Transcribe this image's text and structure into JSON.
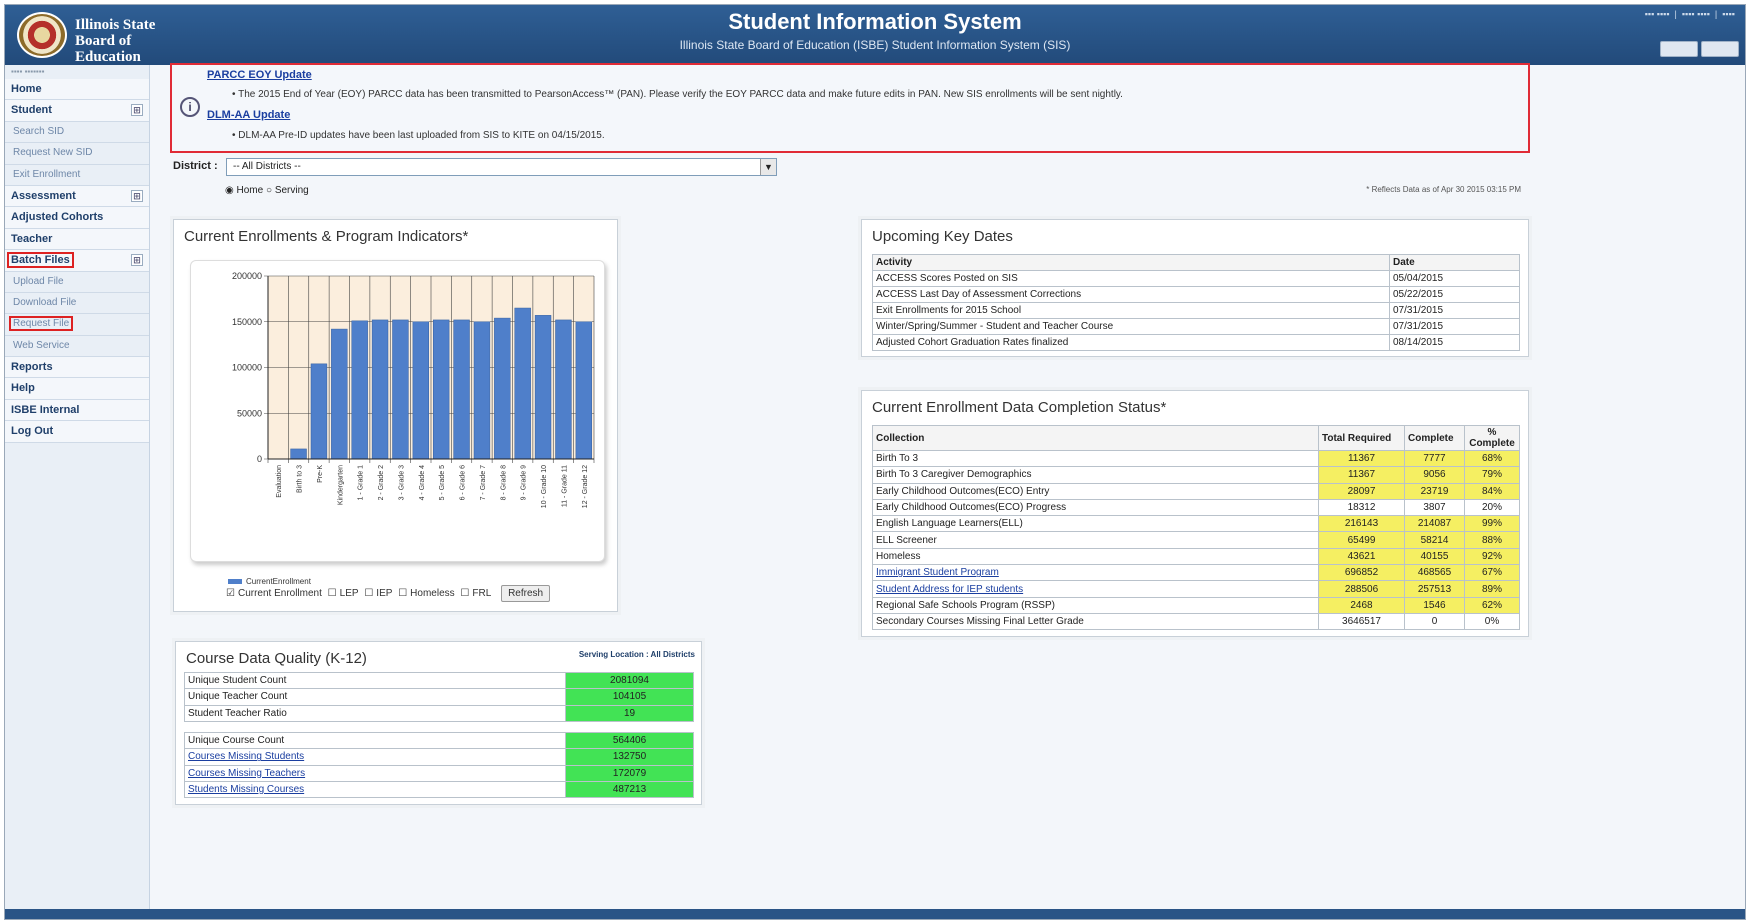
{
  "header": {
    "board_name": "Illinois State Board of Education",
    "app_title": "Student Information System",
    "app_subtitle": "Illinois State Board of Education (ISBE) Student Information System (SIS)"
  },
  "sidebar": {
    "items": [
      {
        "label": "Home",
        "level": "top"
      },
      {
        "label": "Student",
        "level": "top",
        "expand": "⊞"
      },
      {
        "label": "Search SID",
        "level": "sub"
      },
      {
        "label": "Request New SID",
        "level": "sub"
      },
      {
        "label": "Exit Enrollment",
        "level": "sub"
      },
      {
        "label": "Assessment",
        "level": "top",
        "expand": "⊞"
      },
      {
        "label": "Adjusted Cohorts",
        "level": "top"
      },
      {
        "label": "Teacher",
        "level": "top"
      },
      {
        "label": "Batch Files",
        "level": "top",
        "expand": "⊞",
        "highlight": true
      },
      {
        "label": "Upload File",
        "level": "sub"
      },
      {
        "label": "Download File",
        "level": "sub"
      },
      {
        "label": "Request File",
        "level": "sub",
        "highlight": true
      },
      {
        "label": "Web Service",
        "level": "sub"
      },
      {
        "label": "Reports",
        "level": "top"
      },
      {
        "label": "Help",
        "level": "top"
      },
      {
        "label": "ISBE Internal",
        "level": "top"
      },
      {
        "label": "Log Out",
        "level": "top"
      }
    ]
  },
  "notice": {
    "parcc_title": "PARCC EOY Update",
    "parcc_text": "• The 2015 End of Year (EOY) PARCC data has been transmitted to PearsonAccess™ (PAN). Please verify the EOY PARCC data and make future edits in PAN. New SIS enrollments will be sent nightly.",
    "dlm_title": "DLM-AA Update",
    "dlm_text": "• DLM-AA Pre-ID updates have been last uploaded from SIS to KITE on 04/15/2015."
  },
  "filters": {
    "district_label": "District :",
    "district_value": "-- All Districts --",
    "radio_home": "Home",
    "radio_serving": "Serving",
    "as_of": "* Reflects Data as of Apr 30 2015 03:15 PM"
  },
  "enrollment_panel": {
    "title": "Current Enrollments & Program Indicators*",
    "legend": "CurrentEnrollment",
    "checkboxes": [
      "Current Enrollment",
      "LEP",
      "IEP",
      "Homeless",
      "FRL"
    ],
    "refresh_label": "Refresh"
  },
  "chart_data": {
    "type": "bar",
    "title": "",
    "categories": [
      "Evaluation",
      "Birth to 3",
      "Pre-K",
      "Kindergarten",
      "1 - Grade 1",
      "2 - Grade 2",
      "3 - Grade 3",
      "4 - Grade 4",
      "5 - Grade 5",
      "6 - Grade 6",
      "7 - Grade 7",
      "8 - Grade 8",
      "9 - Grade 9",
      "10 - Grade 10",
      "11 - Grade 11",
      "12 - Grade 12"
    ],
    "series": [
      {
        "name": "CurrentEnrollment",
        "values": [
          0,
          11000,
          104000,
          142000,
          151000,
          152000,
          152000,
          150000,
          152000,
          152000,
          150000,
          154000,
          165000,
          157000,
          152000,
          150000
        ]
      }
    ],
    "yticks": [
      "0",
      "50000",
      "100000",
      "150000",
      "200000"
    ],
    "ylim": [
      0,
      200000
    ],
    "bar_color": "#4f7fca"
  },
  "key_dates": {
    "title": "Upcoming Key Dates",
    "headers": [
      "Activity",
      "Date"
    ],
    "rows": [
      [
        "ACCESS Scores Posted on SIS",
        "05/04/2015"
      ],
      [
        "ACCESS Last Day of Assessment Corrections",
        "05/22/2015"
      ],
      [
        "Exit Enrollments for 2015 School",
        "07/31/2015"
      ],
      [
        "Winter/Spring/Summer - Student and Teacher Course",
        "07/31/2015"
      ],
      [
        "Adjusted Cohort Graduation Rates finalized",
        "08/14/2015"
      ]
    ]
  },
  "completion_status": {
    "title": "Current Enrollment Data Completion Status*",
    "headers": [
      "Collection",
      "Total Required",
      "Complete",
      "% Complete"
    ],
    "rows": [
      {
        "collection": "Birth To 3",
        "total": "11367",
        "complete": "7777",
        "pct": "68%",
        "link": false,
        "yellow": true
      },
      {
        "collection": "Birth To 3 Caregiver Demographics",
        "total": "11367",
        "complete": "9056",
        "pct": "79%",
        "link": false,
        "yellow": true
      },
      {
        "collection": "Early Childhood Outcomes(ECO) Entry",
        "total": "28097",
        "complete": "23719",
        "pct": "84%",
        "link": false,
        "yellow": true
      },
      {
        "collection": "Early Childhood Outcomes(ECO) Progress",
        "total": "18312",
        "complete": "3807",
        "pct": "20%",
        "link": false,
        "yellow": false
      },
      {
        "collection": "English Language Learners(ELL)",
        "total": "216143",
        "complete": "214087",
        "pct": "99%",
        "link": false,
        "yellow": true
      },
      {
        "collection": "ELL Screener",
        "total": "65499",
        "complete": "58214",
        "pct": "88%",
        "link": false,
        "yellow": true
      },
      {
        "collection": "Homeless",
        "total": "43621",
        "complete": "40155",
        "pct": "92%",
        "link": false,
        "yellow": true
      },
      {
        "collection": "Immigrant Student Program",
        "total": "696852",
        "complete": "468565",
        "pct": "67%",
        "link": true,
        "yellow": true
      },
      {
        "collection": "Student Address for IEP students",
        "total": "288506",
        "complete": "257513",
        "pct": "89%",
        "link": true,
        "yellow": true
      },
      {
        "collection": "Regional Safe Schools Program (RSSP)",
        "total": "2468",
        "complete": "1546",
        "pct": "62%",
        "link": false,
        "yellow": true
      },
      {
        "collection": "Secondary Courses Missing Final Letter Grade",
        "total": "3646517",
        "complete": "0",
        "pct": "0%",
        "link": false,
        "yellow": false
      }
    ]
  },
  "course_quality": {
    "title": "Course Data Quality (K-12)",
    "serving_location": "Serving Location : All Districts",
    "group1": [
      {
        "label": "Unique Student Count",
        "value": "2081094",
        "link": false
      },
      {
        "label": "Unique Teacher Count",
        "value": "104105",
        "link": false
      },
      {
        "label": "Student Teacher Ratio",
        "value": "19",
        "link": false
      }
    ],
    "group2": [
      {
        "label": "Unique Course Count",
        "value": "564406",
        "link": false
      },
      {
        "label": "Courses Missing Students",
        "value": "132750",
        "link": true
      },
      {
        "label": "Courses Missing Teachers",
        "value": "172079",
        "link": true
      },
      {
        "label": "Students Missing Courses",
        "value": "487213",
        "link": true
      }
    ]
  }
}
